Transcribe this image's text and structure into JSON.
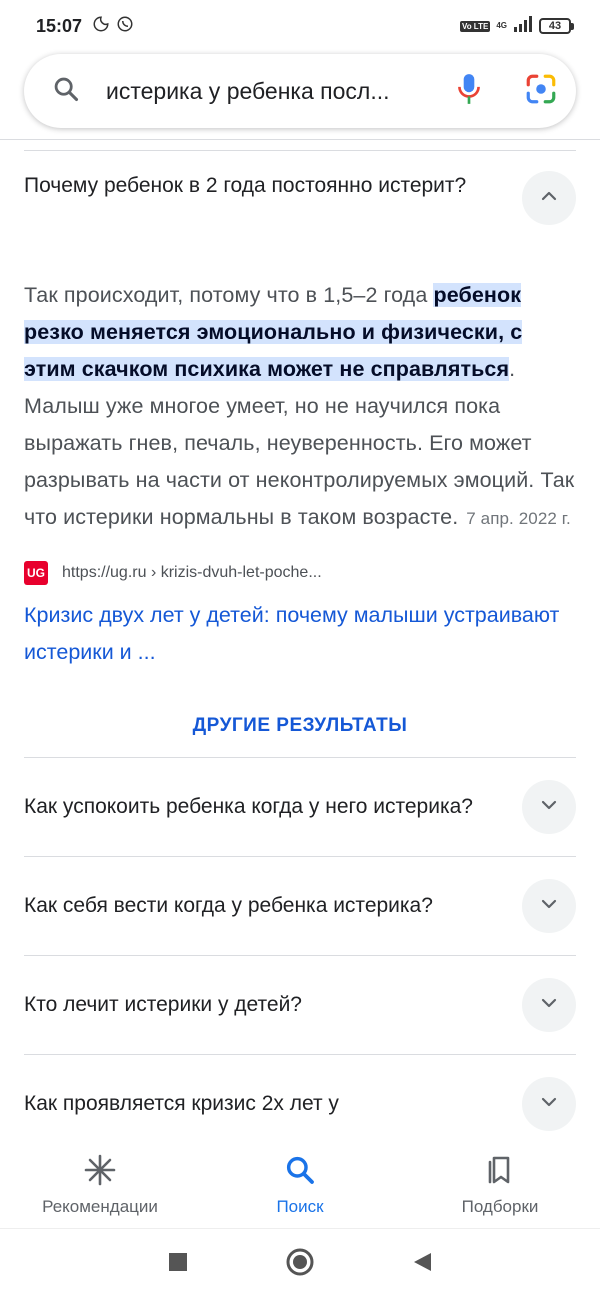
{
  "status": {
    "time": "15:07",
    "volte": "Vo LTE",
    "network": "4G",
    "battery": "43"
  },
  "search": {
    "query": "истерика у ребенка посл..."
  },
  "expanded": {
    "question": "Почему ребенок в 2 года постоянно истерит?",
    "answer_before": "Так происходит, потому что в 1,5–2 года ",
    "answer_highlight": "ребенок резко меняется эмоционально и физически, с этим скачком психика может не справляться",
    "answer_after": ". Малыш уже многое умеет, но не научился пока выражать гнев, печаль, неуверенность. Его может разрывать на части от неконтролируемых эмоций. Так что истерики нормальны в таком возрасте.",
    "date": "7 апр. 2022 г.",
    "source_favicon": "UG",
    "source_url": "https://ug.ru › krizis-dvuh-let-poche...",
    "result_title": "Кризис двух лет у детей: почему малыши устраивают истерики и ..."
  },
  "more_results_label": "ДРУГИЕ РЕЗУЛЬТАТЫ",
  "questions": [
    {
      "text": "Как успокоить ребенка когда у него истерика?"
    },
    {
      "text": "Как себя вести когда у ребенка истерика?"
    },
    {
      "text": "Кто лечит истерики у детей?"
    },
    {
      "text": "Как проявляется кризис 2х лет у"
    }
  ],
  "bottom_nav": {
    "recommendations": "Рекомендации",
    "search": "Поиск",
    "collections": "Подборки"
  },
  "colors": {
    "link": "#1558d6",
    "highlight": "#d3e3fd",
    "active_nav": "#1a73e8"
  }
}
